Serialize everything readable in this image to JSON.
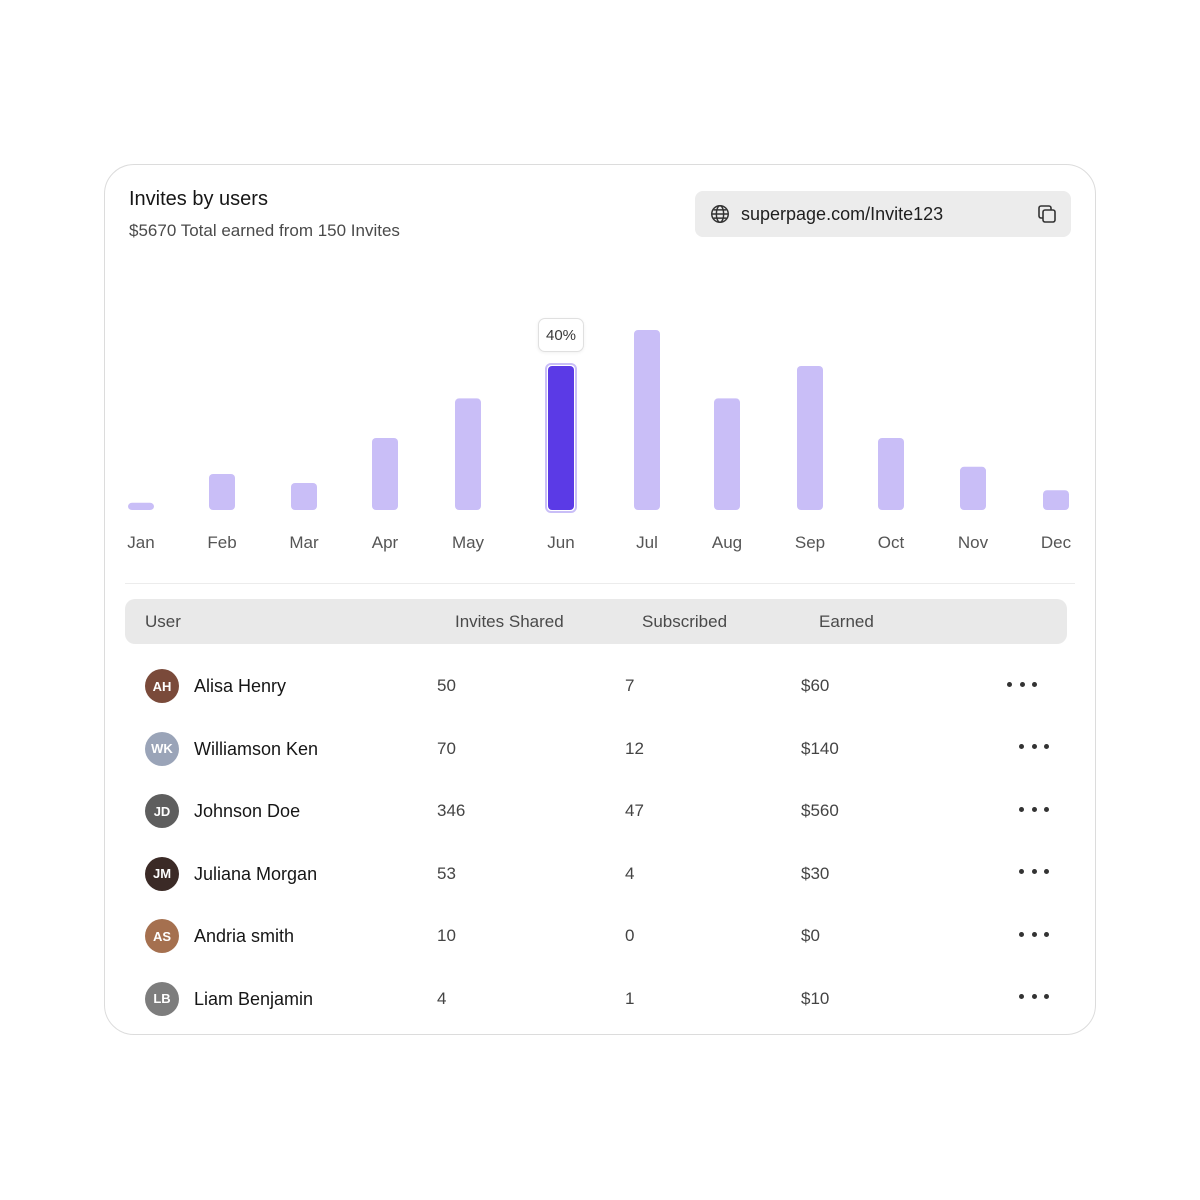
{
  "card": {
    "title": "Invites by users",
    "subtitle": "$5670 Total earned from 150 Invites"
  },
  "invite_link": {
    "url": "superpage.com/Invite123",
    "leading_icon": "globe-icon",
    "action_icon": "copy-icon"
  },
  "chart_data": {
    "type": "bar",
    "categories": [
      "Jan",
      "Feb",
      "Mar",
      "Apr",
      "May",
      "Jun",
      "Jul",
      "Aug",
      "Sep",
      "Oct",
      "Nov",
      "Dec"
    ],
    "values": [
      4,
      20,
      15,
      40,
      62,
      80,
      100,
      62,
      80,
      40,
      24,
      11
    ],
    "highlighted_index": 5,
    "tooltip": "40%",
    "colors": {
      "bar": "#c9bef7",
      "highlight": "#5b3ae6"
    }
  },
  "table": {
    "columns": [
      "User",
      "Invites Shared",
      "Subscribed",
      "Earned"
    ],
    "rows": [
      {
        "user": "Alisa Henry",
        "invites": "50",
        "subscribed": "7",
        "earned": "$60",
        "avatar_color": "#7a4a3a"
      },
      {
        "user": "Williamson Ken",
        "invites": "70",
        "subscribed": "12",
        "earned": "$140",
        "avatar_color": "#9aa4b8"
      },
      {
        "user": "Johnson Doe",
        "invites": "346",
        "subscribed": "47",
        "earned": "$560",
        "avatar_color": "#5e5e5e"
      },
      {
        "user": "Juliana Morgan",
        "invites": "53",
        "subscribed": "4",
        "earned": "$30",
        "avatar_color": "#3b2a26"
      },
      {
        "user": "Andria smith",
        "invites": "10",
        "subscribed": "0",
        "earned": "$0",
        "avatar_color": "#a5704f"
      },
      {
        "user": "Liam Benjamin",
        "invites": "4",
        "subscribed": "1",
        "earned": "$10",
        "avatar_color": "#7d7d7d"
      }
    ],
    "row_action_icon": "more-horizontal-icon"
  }
}
